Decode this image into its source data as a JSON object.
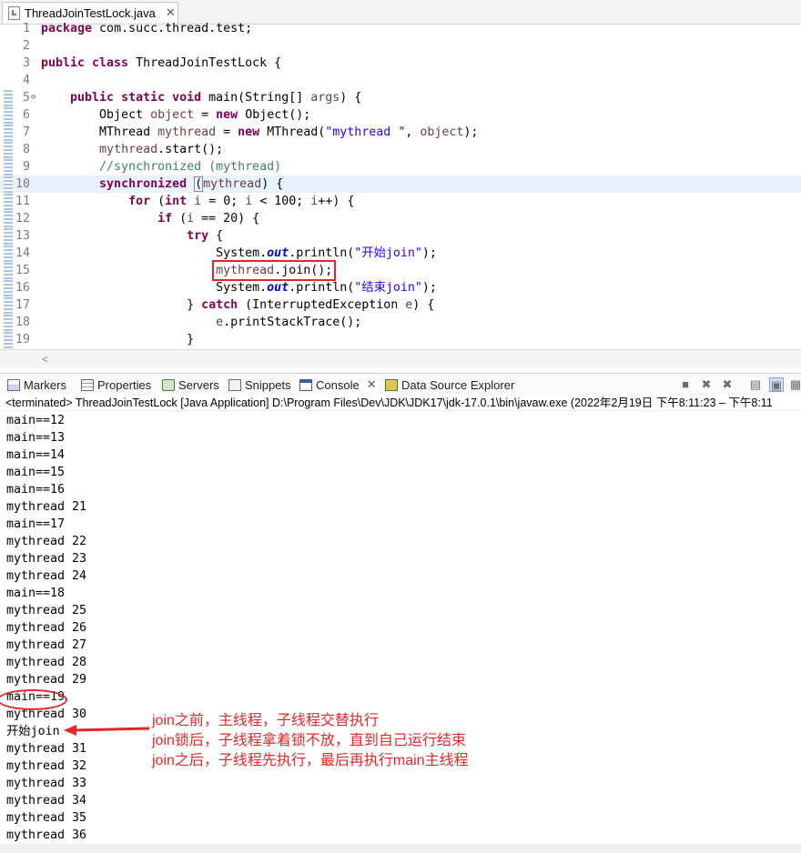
{
  "editor": {
    "tab": {
      "label": "ThreadJoinTestLock.java",
      "close": "✕"
    },
    "lines": [
      {
        "n": "1",
        "html": "<span class=\"kw\">package</span> com.succ.thread.test;"
      },
      {
        "n": "2",
        "html": ""
      },
      {
        "n": "3",
        "html": "<span class=\"kw\">public class</span> ThreadJoinTestLock {"
      },
      {
        "n": "4",
        "html": ""
      },
      {
        "n": "5",
        "html": "    <span class=\"kw\">public static void</span> main(String[] <span class=\"var\">args</span>) {",
        "fold": "⊖"
      },
      {
        "n": "6",
        "html": "        Object <span class=\"var\">object</span> = <span class=\"kw\">new</span> Object();"
      },
      {
        "n": "7",
        "html": "        MThread <span class=\"var\">mythread</span> = <span class=\"kw\">new</span> MThread(<span class=\"str\">\"mythread \"</span>, <span class=\"var\">object</span>);"
      },
      {
        "n": "8",
        "html": "        <span class=\"var\">mythread</span>.start();"
      },
      {
        "n": "9",
        "html": "        <span class=\"cmt\">//synchronized (mythread)</span>"
      },
      {
        "n": "10",
        "html": "        <span class=\"kw\">synchronized</span> <span class=\"mark\">(</span><span class=\"var\">mythread</span>) {",
        "hl": true
      },
      {
        "n": "11",
        "html": "            <span class=\"kw\">for</span> (<span class=\"kw\">int</span> <span class=\"var\">i</span> = 0; <span class=\"var\">i</span> &lt; 100; <span class=\"var\">i</span>++) {"
      },
      {
        "n": "12",
        "html": "                <span class=\"kw\">if</span> (<span class=\"var\">i</span> == 20) {"
      },
      {
        "n": "13",
        "html": "                    <span class=\"kw\">try</span> {"
      },
      {
        "n": "14",
        "html": "                        System.<span class=\"fld\">out</span>.println(<span class=\"str\">\"开始join\"</span>);"
      },
      {
        "n": "15",
        "html": "                        <span class=\"redbox\"><span class=\"var\">mythread</span>.join();</span>"
      },
      {
        "n": "16",
        "html": "                        System.<span class=\"fld\">out</span>.println(<span class=\"str\">\"结束join\"</span>);"
      },
      {
        "n": "17",
        "html": "                    } <span class=\"kw\">catch</span> (InterruptedException <span class=\"var\">e</span>) {"
      },
      {
        "n": "18",
        "html": "                        <span class=\"var\">e</span>.printStackTrace();"
      },
      {
        "n": "19",
        "html": "                    }"
      }
    ]
  },
  "views": {
    "tabs": [
      "Markers",
      "Properties",
      "Servers",
      "Snippets",
      "Console",
      "Data Source Explorer"
    ],
    "active_tab": "Console",
    "close": "✕"
  },
  "console": {
    "status": "<terminated> ThreadJoinTestLock [Java Application] D:\\Program Files\\Dev\\JDK\\JDK17\\jdk-17.0.1\\bin\\javaw.exe  (2022年2月19日 下午8:11:23 – 下午8:11",
    "lines": [
      "main==12",
      "main==13",
      "main==14",
      "main==15",
      "main==16",
      "mythread 21",
      "main==17",
      "mythread 22",
      "mythread 23",
      "mythread 24",
      "main==18",
      "mythread 25",
      "mythread 26",
      "mythread 27",
      "mythread 28",
      "mythread 29",
      "main==19",
      "mythread 30",
      "开始join",
      "mythread 31",
      "mythread 32",
      "mythread 33",
      "mythread 34",
      "mythread 35",
      "mythread 36"
    ]
  },
  "annotations": [
    "join之前，主线程，子线程交替执行",
    "join锁后，子线程拿着锁不放，直到自己运行结束",
    "join之后，子线程先执行，最后再执行main主线程"
  ],
  "colors": {
    "annotation": "#e0282a",
    "keyword": "#7f0055",
    "string": "#2a00ff",
    "comment": "#3f7f5f"
  }
}
